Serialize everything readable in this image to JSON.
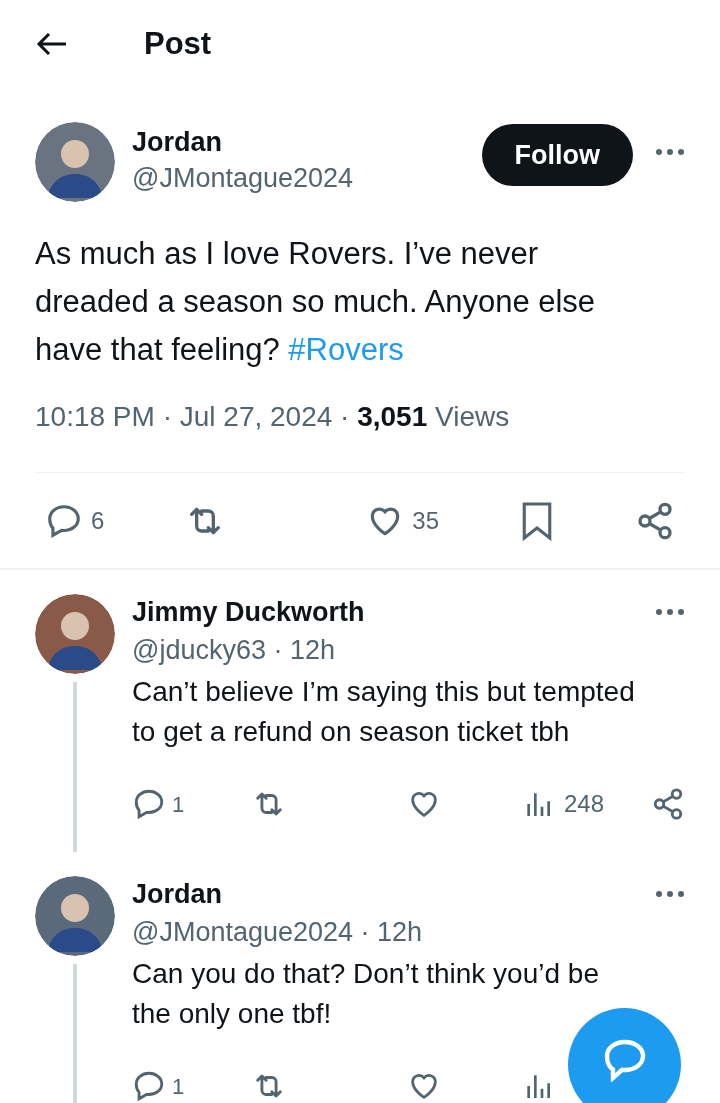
{
  "header": {
    "title": "Post"
  },
  "post": {
    "name": "Jordan",
    "handle": "@JMontague2024",
    "follow": "Follow",
    "text": "As much as I love Rovers. I’ve never dreaded a season so much. Anyone else have that feeling? ",
    "hashtag": "#Rovers",
    "time": "10:18 PM · Jul 27, 2024 · ",
    "views_count": "3,051",
    "views_label": " Views",
    "replies": "6",
    "likes": "35"
  },
  "replies": [
    {
      "name": "Jimmy Duckworth",
      "handle": "@jducky63 · 12h",
      "text": "Can’t believe I’m saying this but tempted to get a refund on season ticket tbh",
      "replies": "1",
      "views": "248",
      "covered": false
    },
    {
      "name": "Jordan",
      "handle": "@JMontague2024 · 12h",
      "text": "Can you do that? Don’t think you’d be the only one tbf!",
      "replies": "1",
      "covered": true
    }
  ]
}
